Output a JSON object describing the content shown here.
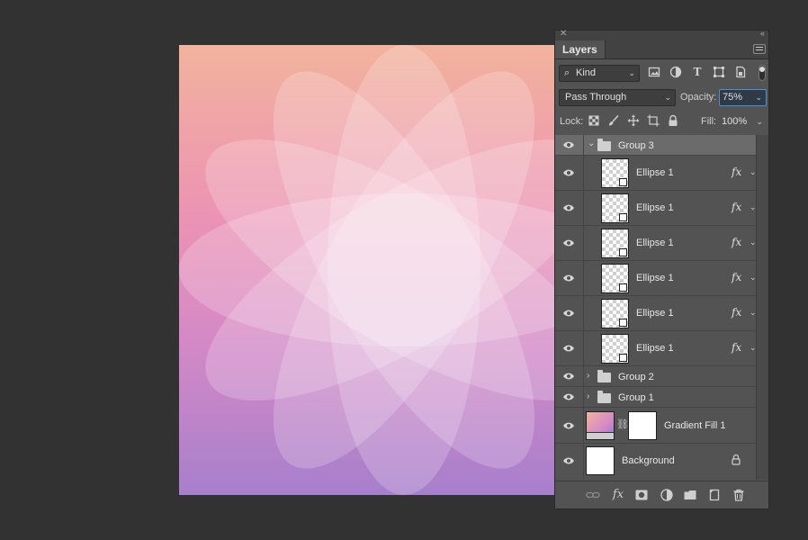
{
  "panel": {
    "close_glyph": "✕",
    "collapse_glyph": "‹‹",
    "tab_label": "Layers",
    "menu_icon": "panel-menu-icon"
  },
  "filter": {
    "kind_label": "Kind",
    "icons": [
      "image-filter-icon",
      "adjustment-filter-icon",
      "type-filter-icon",
      "shape-filter-icon",
      "smart-object-filter-icon"
    ]
  },
  "blend": {
    "mode": "Pass Through",
    "opacity_label": "Opacity:",
    "opacity_value": "75%"
  },
  "lock": {
    "label": "Lock:",
    "icons": [
      "lock-transparent-icon",
      "lock-paint-icon",
      "lock-position-icon",
      "lock-artboard-icon",
      "lock-all-icon"
    ],
    "fill_label": "Fill:",
    "fill_value": "100%"
  },
  "layers": [
    {
      "name": "Group 3",
      "type": "group",
      "expanded": true,
      "selected": true
    },
    {
      "name": "Ellipse 1",
      "type": "shape",
      "fx": "fx"
    },
    {
      "name": "Ellipse 1",
      "type": "shape",
      "fx": "fx"
    },
    {
      "name": "Ellipse 1",
      "type": "shape",
      "fx": "fx"
    },
    {
      "name": "Ellipse 1",
      "type": "shape",
      "fx": "fx"
    },
    {
      "name": "Ellipse 1",
      "type": "shape",
      "fx": "fx"
    },
    {
      "name": "Ellipse 1",
      "type": "shape",
      "fx": "fx"
    },
    {
      "name": "Group 2",
      "type": "group",
      "expanded": false
    },
    {
      "name": "Group 1",
      "type": "group",
      "expanded": false
    },
    {
      "name": "Gradient Fill 1",
      "type": "gradient"
    },
    {
      "name": "Background",
      "type": "background",
      "locked": true
    }
  ],
  "bottom_icons": [
    "link-layers-icon",
    "fx-icon",
    "add-mask-icon",
    "adjustment-layer-icon",
    "new-group-icon",
    "new-layer-icon",
    "delete-layer-icon"
  ],
  "colors": {
    "workspace": "#323232",
    "panel": "#535353",
    "selected_row": "#6b6b6b",
    "accent": "#4a90d9",
    "gradient_top": "#f2b39c",
    "gradient_bottom": "#a77fcc"
  }
}
